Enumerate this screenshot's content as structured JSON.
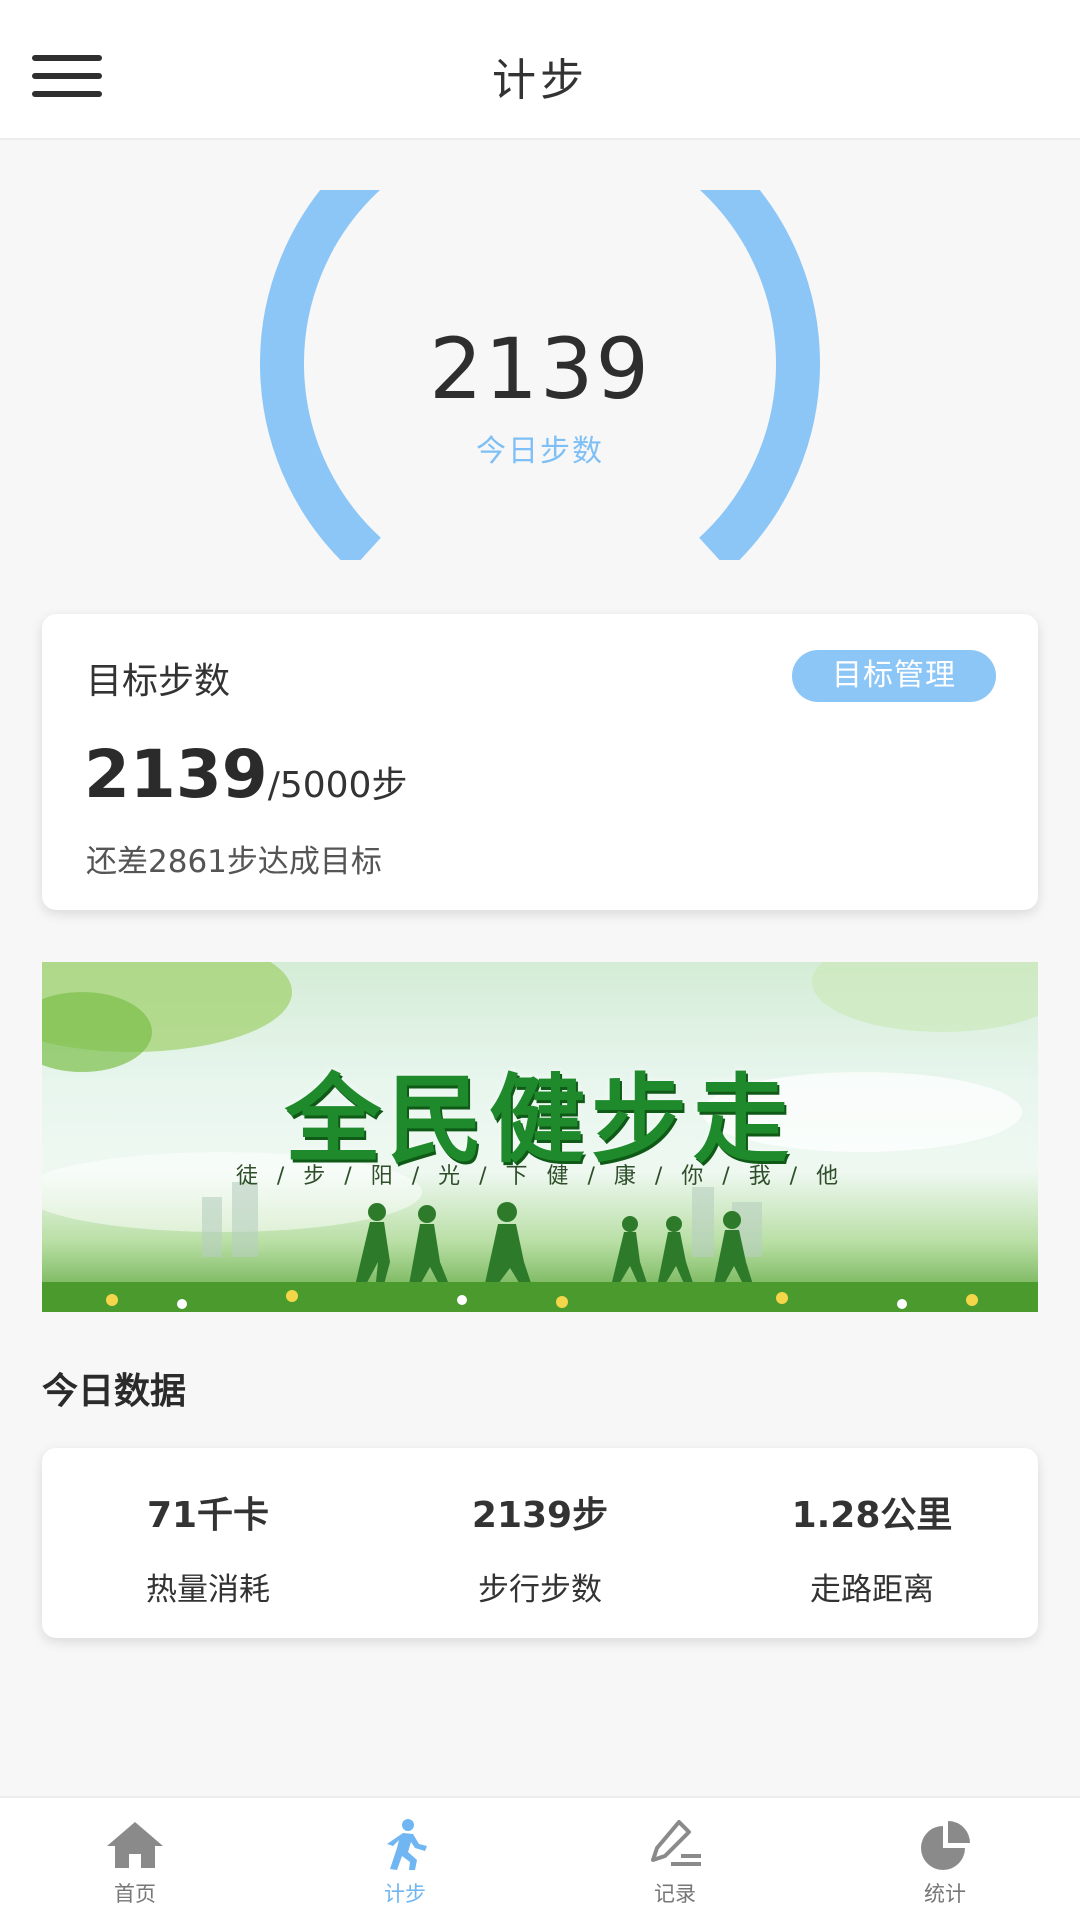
{
  "header": {
    "title": "计步"
  },
  "gauge": {
    "steps": "2139",
    "label": "今日步数",
    "color": "#8cc6f7"
  },
  "goal": {
    "title": "目标步数",
    "manage_button": "目标管理",
    "current": "2139",
    "target": "/5000步",
    "remaining": "还差2861步达成目标"
  },
  "banner": {
    "title": "全民健步走",
    "subtitle": "徒 / 步 / 阳 / 光 / 下    健 / 康 / 你 / 我 / 他"
  },
  "today": {
    "section_title": "今日数据",
    "stats": [
      {
        "value": "71千卡",
        "label": "热量消耗"
      },
      {
        "value": "2139步",
        "label": "步行步数"
      },
      {
        "value": "1.28公里",
        "label": "走路距离"
      }
    ]
  },
  "tabbar": {
    "active_color": "#6fb6f2",
    "tabs": [
      {
        "label": "首页",
        "icon": "home-icon"
      },
      {
        "label": "计步",
        "icon": "walking-icon",
        "active": true
      },
      {
        "label": "记录",
        "icon": "pen-icon"
      },
      {
        "label": "统计",
        "icon": "pie-chart-icon"
      }
    ]
  }
}
